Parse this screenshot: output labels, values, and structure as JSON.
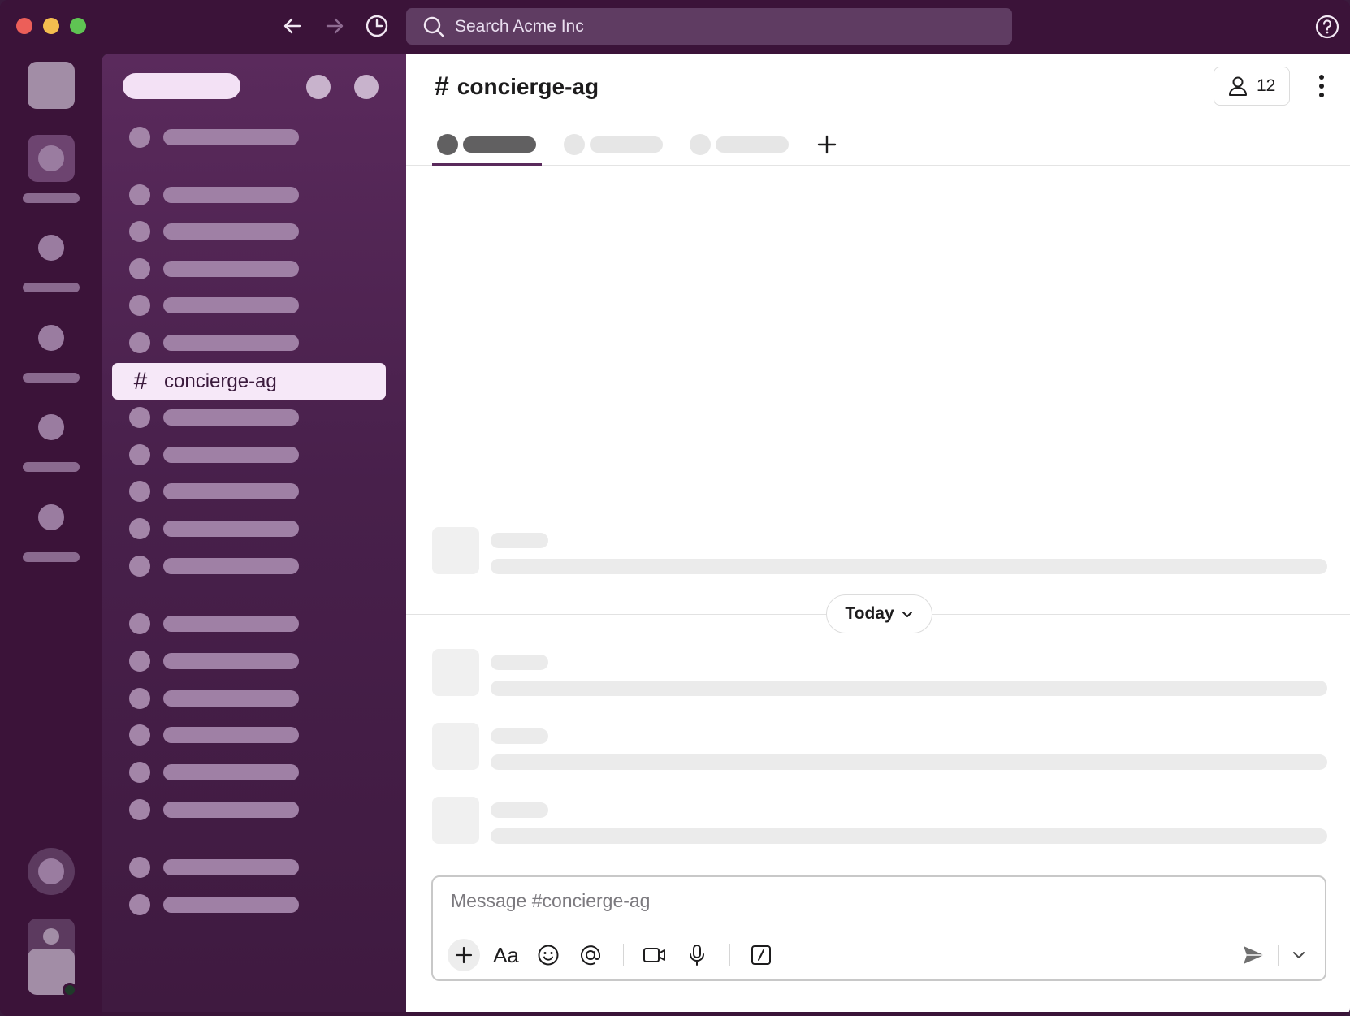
{
  "search": {
    "placeholder": "Search Acme Inc"
  },
  "channel": {
    "name": "concierge-ag",
    "member_count": "12"
  },
  "sidebar": {
    "active_channel": "concierge-ag",
    "hash": "#"
  },
  "divider": {
    "label": "Today"
  },
  "composer": {
    "placeholder": "Message #concierge-ag",
    "format_label": "Aa"
  },
  "icons": [
    "back-arrow-icon",
    "forward-arrow-icon",
    "history-icon",
    "search-icon",
    "help-icon",
    "person-icon",
    "more-vertical-icon",
    "plus-icon",
    "emoji-icon",
    "mention-icon",
    "video-icon",
    "microphone-icon",
    "slash-command-icon",
    "send-icon",
    "chevron-down-icon"
  ],
  "colors": {
    "sidebar": "#4a204c",
    "active_channel_bg": "#f6e8f8",
    "titlebar": "#3b1339"
  }
}
